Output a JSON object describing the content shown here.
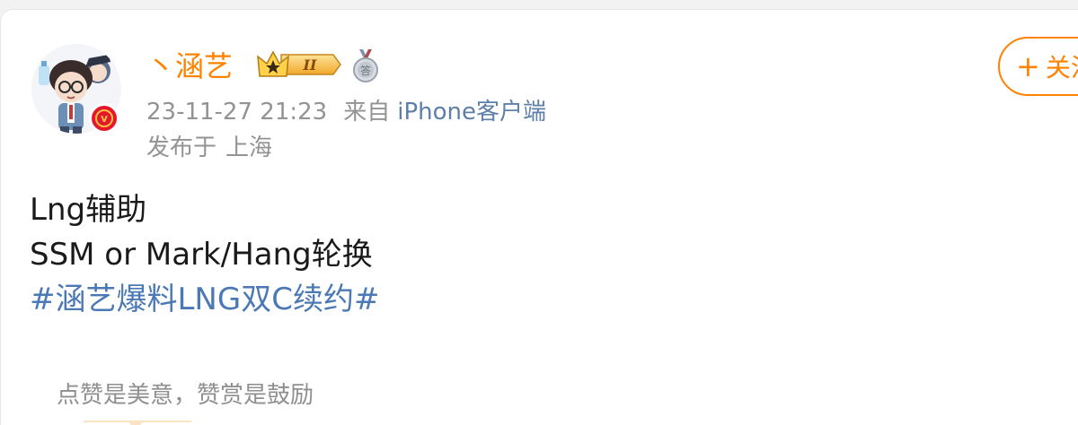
{
  "post": {
    "author": {
      "name": "丶涵艺",
      "avatar_icon": "cartoon-avatar",
      "verified_icon": "vip-badge-icon",
      "verified_letter": "v",
      "crown_label": "II",
      "medal_label": "答"
    },
    "timestamp": "23-11-27 21:23",
    "from_label": "来自",
    "source": "iPhone客户端",
    "location_label": "发布于",
    "location": "上海",
    "follow": {
      "plus": "+",
      "label": "关注"
    },
    "content": {
      "line1": "Lng辅助",
      "line2": "SSM or  Mark/Hang轮换",
      "hashtag": "#涵艺爆料LNG双C续约#"
    },
    "reward_prompt": "点赞是美意，赞赏是鼓励"
  },
  "colors": {
    "brand_orange": "#ff8200",
    "link_blue": "#4a79b5",
    "meta_gray": "#939393",
    "vip_red": "#e6162d"
  }
}
